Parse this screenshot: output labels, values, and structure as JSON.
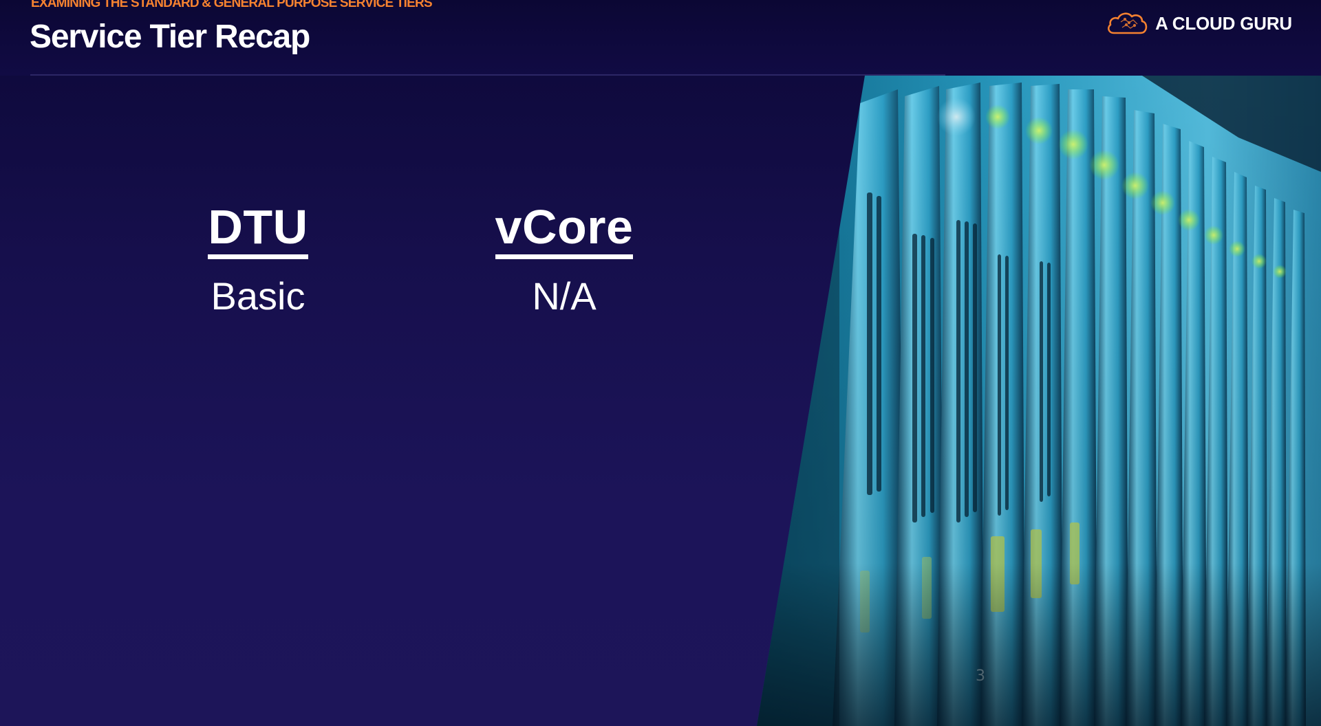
{
  "slide": {
    "eyebrow": "EXAMINING THE STANDARD & GENERAL PURPOSE SERVICE TIERS",
    "title": "Service Tier Recap"
  },
  "brand": {
    "name": "A CLOUD GURU",
    "logo_icon": "cloud-logo-icon",
    "accent_color": "#f58230"
  },
  "columns": [
    {
      "heading": "DTU",
      "items": [
        "Basic"
      ]
    },
    {
      "heading": "vCore",
      "items": [
        "N/A"
      ]
    }
  ],
  "photo": {
    "description_icon": "server-rack-photo",
    "drive_label": "3"
  },
  "colors": {
    "background": "#1b1457",
    "header": "#0c0837",
    "text": "#ffffff"
  }
}
